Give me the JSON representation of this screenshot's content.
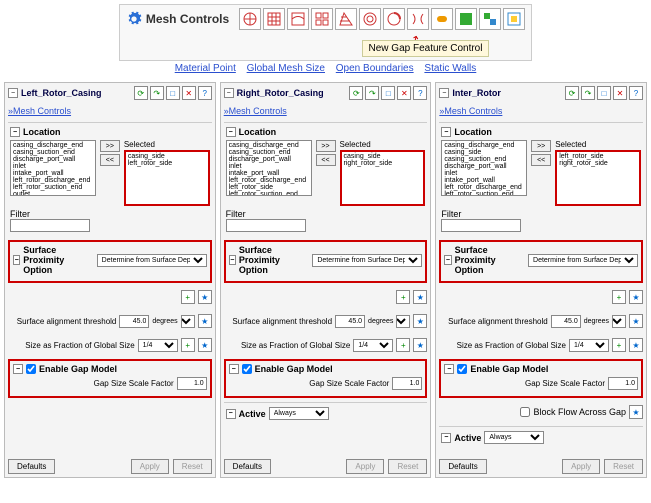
{
  "topbar": {
    "title": "Mesh Controls",
    "callout": "New Gap Feature Control",
    "links": [
      "Material Point",
      "Global Mesh Size",
      "Open Boundaries",
      "Static Walls"
    ]
  },
  "common": {
    "mesh_controls_link": "»Mesh Controls",
    "location_label": "Location",
    "selected_label": "Selected",
    "filter_label": "Filter",
    "move_r": ">>",
    "move_l": "<<",
    "spo_label": "Surface Proximity Option",
    "spo_value": "Determine from Surface Depth",
    "sat_label": "Surface alignment threshold",
    "sat_value": "45.0",
    "sat_unit": "degrees",
    "sfgs_label": "Size as Fraction of Global Size",
    "sfgs_value": "1/4",
    "egm_label": "Enable Gap Model",
    "gssf_label": "Gap Size Scale Factor",
    "gssf_value": "1.0",
    "bfag_label": "Block Flow Across Gap",
    "active_label": "Active",
    "active_value": "Always",
    "defaults": "Defaults",
    "apply": "Apply",
    "reset": "Reset"
  },
  "panels": [
    {
      "title": "Left_Rotor_Casing",
      "avail": [
        "casing_discharge_end",
        "casing_suction_end",
        "discharge_port_wall",
        "inlet",
        "intake_port_wall",
        "left_rotor_discharge_end",
        "left_rotor_suction_end",
        "outlet"
      ],
      "selected": [
        "casing_side",
        "left_rotor_side"
      ],
      "show_bfag": false,
      "show_active": false
    },
    {
      "title": "Right_Rotor_Casing",
      "avail": [
        "casing_discharge_end",
        "casing_suction_end",
        "discharge_port_wall",
        "inlet",
        "intake_port_wall",
        "left_rotor_discharge_end",
        "left_rotor_side",
        "left_rotor_suction_end"
      ],
      "selected": [
        "casing_side",
        "right_rotor_side"
      ],
      "show_bfag": false,
      "show_active": true
    },
    {
      "title": "Inter_Rotor",
      "avail": [
        "casing_discharge_end",
        "casing_side",
        "casing_suction_end",
        "discharge_port_wall",
        "inlet",
        "intake_port_wall",
        "left_rotor_discharge_end",
        "left_rotor_suction_end"
      ],
      "selected": [
        "left_rotor_side",
        "right_rotor_side"
      ],
      "show_bfag": true,
      "show_active": true
    }
  ]
}
